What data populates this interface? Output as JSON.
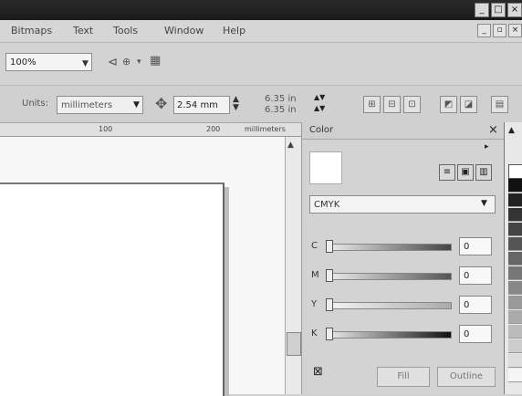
{
  "window": {
    "controls": {
      "minimize": "_",
      "maximize": "□",
      "close": "×"
    }
  },
  "menubar": {
    "items": [
      "Bitmaps",
      "Text",
      "Tools",
      "Window",
      "Help"
    ],
    "mdi_controls": {
      "minimize": "_",
      "restore": "▫",
      "close": "×"
    }
  },
  "toolbar": {
    "zoom_value": "100%"
  },
  "propertybar": {
    "units_label": "Units:",
    "units_value": "millimeters",
    "nudge_value": "2.54 mm",
    "duplicate_x": "6.35 in",
    "duplicate_y": "6.35 in"
  },
  "ruler": {
    "tick_a": "100",
    "tick_b": "200",
    "unit_label": "millimeters"
  },
  "color_docker": {
    "title": "Color",
    "color_model": "CMYK",
    "channels": [
      {
        "label": "C",
        "value": "0"
      },
      {
        "label": "M",
        "value": "0"
      },
      {
        "label": "Y",
        "value": "0"
      },
      {
        "label": "K",
        "value": "0"
      }
    ],
    "fill_button": "Fill",
    "outline_button": "Outline"
  }
}
